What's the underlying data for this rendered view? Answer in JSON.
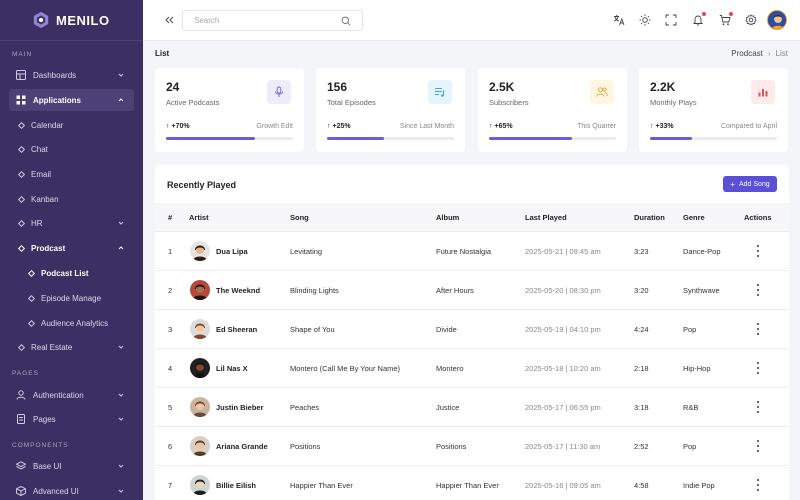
{
  "app": {
    "name": "MENILO"
  },
  "sidebar": {
    "sections": {
      "main": "MAIN",
      "pages": "PAGES",
      "components": "COMPONENTS"
    },
    "items": [
      {
        "label": "Dashboards"
      },
      {
        "label": "Applications"
      },
      {
        "label": "Calendar"
      },
      {
        "label": "Chat"
      },
      {
        "label": "Email"
      },
      {
        "label": "Kanban"
      },
      {
        "label": "HR"
      },
      {
        "label": "Prodcast"
      },
      {
        "label": "Podcast List"
      },
      {
        "label": "Episode Manage"
      },
      {
        "label": "Audience Analytics"
      },
      {
        "label": "Real Estate"
      },
      {
        "label": "Authentication"
      },
      {
        "label": "Pages"
      },
      {
        "label": "Base UI"
      },
      {
        "label": "Advanced UI"
      }
    ]
  },
  "topbar": {
    "search_placeholder": "Search"
  },
  "page": {
    "title": "List",
    "breadcrumb": [
      "Prodcast",
      "List"
    ]
  },
  "stats": [
    {
      "value": "24",
      "label": "Active Podcasts",
      "change": "+70%",
      "note": "Growth Edit",
      "progress": 0.7,
      "icon": "microphone-icon"
    },
    {
      "value": "156",
      "label": "Total Episodes",
      "change": "+25%",
      "note": "Since Last Month",
      "progress": 0.45,
      "icon": "playlist-icon"
    },
    {
      "value": "2.5K",
      "label": "Subscribers",
      "change": "+65%",
      "note": "This Quarter",
      "progress": 0.65,
      "icon": "users-icon"
    },
    {
      "value": "2.2K",
      "label": "Monthly Plays",
      "change": "+33%",
      "note": "Compared to April",
      "progress": 0.33,
      "icon": "bar-chart-icon"
    }
  ],
  "colors": {
    "sidebar": "#3b2f63",
    "accent": "#5a4fd6",
    "progress": "#6a5ce0",
    "stat_icon_bg": [
      "#eeecfb",
      "#e6f4fb",
      "#fdf6e3",
      "#fdeaea"
    ],
    "stat_icon_fg": [
      "#6a5ce0",
      "#2ea3d6",
      "#e0a82e",
      "#e05555"
    ]
  },
  "table": {
    "title": "Recently Played",
    "add_button": "Add Song",
    "columns": [
      "#",
      "Artist",
      "Song",
      "Album",
      "Last Played",
      "Duration",
      "Genre",
      "Actions"
    ],
    "rows": [
      {
        "num": "1",
        "artist": "Dua Lipa",
        "song": "Levitating",
        "album": "Future Nostalgia",
        "last_played": "2025-05-21 | 09:45 am",
        "duration": "3:23",
        "genre": "Dance-Pop"
      },
      {
        "num": "2",
        "artist": "The Weeknd",
        "song": "Blinding Lights",
        "album": "After Hours",
        "last_played": "2025-05-20 | 08:30 pm",
        "duration": "3:20",
        "genre": "Synthwave"
      },
      {
        "num": "3",
        "artist": "Ed Sheeran",
        "song": "Shape of You",
        "album": "Divide",
        "last_played": "2025-05-19 | 04:10 pm",
        "duration": "4:24",
        "genre": "Pop"
      },
      {
        "num": "4",
        "artist": "Lil Nas X",
        "song": "Montero (Call Me By Your Name)",
        "album": "Montero",
        "last_played": "2025-05-18 | 10:20 am",
        "duration": "2:18",
        "genre": "Hip-Hop"
      },
      {
        "num": "5",
        "artist": "Justin Bieber",
        "song": "Peaches",
        "album": "Justice",
        "last_played": "2025-05-17 | 06:55 pm",
        "duration": "3:18",
        "genre": "R&B"
      },
      {
        "num": "6",
        "artist": "Ariana Grande",
        "song": "Positions",
        "album": "Positions",
        "last_played": "2025-05-17 | 11:30 am",
        "duration": "2:52",
        "genre": "Pop"
      },
      {
        "num": "7",
        "artist": "Billie Eilish",
        "song": "Happier Than Ever",
        "album": "Happier Than Ever",
        "last_played": "2025-05-16 | 09:05 am",
        "duration": "4:58",
        "genre": "Indie Pop"
      }
    ]
  }
}
